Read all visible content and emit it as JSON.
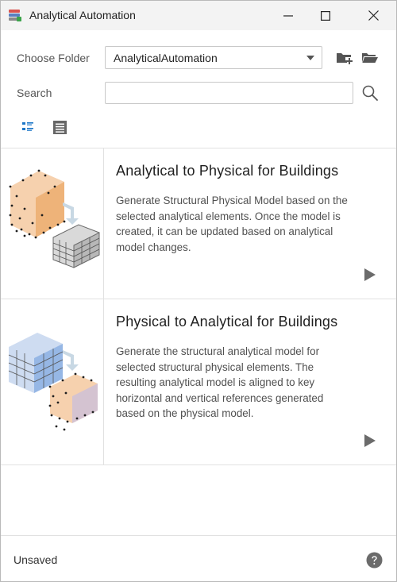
{
  "window": {
    "title": "Analytical Automation"
  },
  "controls": {
    "choose_folder_label": "Choose Folder",
    "folder_value": "AnalyticalAutomation",
    "search_label": "Search",
    "search_value": "",
    "search_placeholder": ""
  },
  "view_toggle": {
    "active": "list-detailed"
  },
  "automations": [
    {
      "title": "Analytical to Physical for Buildings",
      "description_lines": [
        "Generate Structural Physical Model based on the",
        "selected analytical elements. Once the model is",
        "created, it can be updated based on analytical",
        "model changes."
      ]
    },
    {
      "title": "Physical to Analytical for Buildings",
      "description_lines": [
        "Generate the structural analytical model for",
        "selected structural physical elements. The",
        "resulting analytical model is aligned to key",
        "horizontal and vertical references generated",
        "based on the physical model."
      ]
    }
  ],
  "status": {
    "text": "Unsaved"
  },
  "colors": {
    "accent_blue": "#1c76c7",
    "icon_gray": "#555555",
    "play_gray": "#6b6b6b",
    "analytical_orange": "#e89a4f",
    "analytical_blue": "#7fa6e0"
  },
  "icons": {
    "app": "stacked-layers-icon",
    "new_folder": "folder-add-icon",
    "open_folder": "folder-open-icon",
    "search": "search-icon",
    "run": "play-icon",
    "help": "help-icon"
  }
}
